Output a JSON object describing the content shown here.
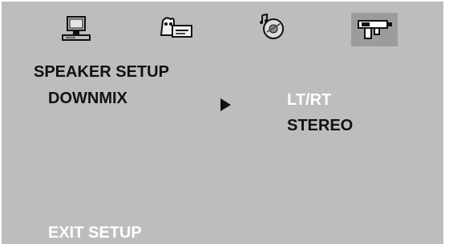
{
  "menu": {
    "icons": [
      {
        "name": "general-setup-icon"
      },
      {
        "name": "speaker-setup-icon"
      },
      {
        "name": "audio-setup-icon"
      },
      {
        "name": "preferences-icon",
        "selected": true
      }
    ],
    "section_title": "SPEAKER SETUP",
    "item_label": "DOWNMIX",
    "options": [
      {
        "label": "LT/RT",
        "highlighted": true
      },
      {
        "label": "STEREO",
        "highlighted": false
      }
    ],
    "exit_label": "EXIT SETUP"
  },
  "colors": {
    "background": "#bdbdbd",
    "selected_icon_bg": "#9c9c9c",
    "text_dark": "#111111",
    "text_highlight": "#ffffff"
  }
}
